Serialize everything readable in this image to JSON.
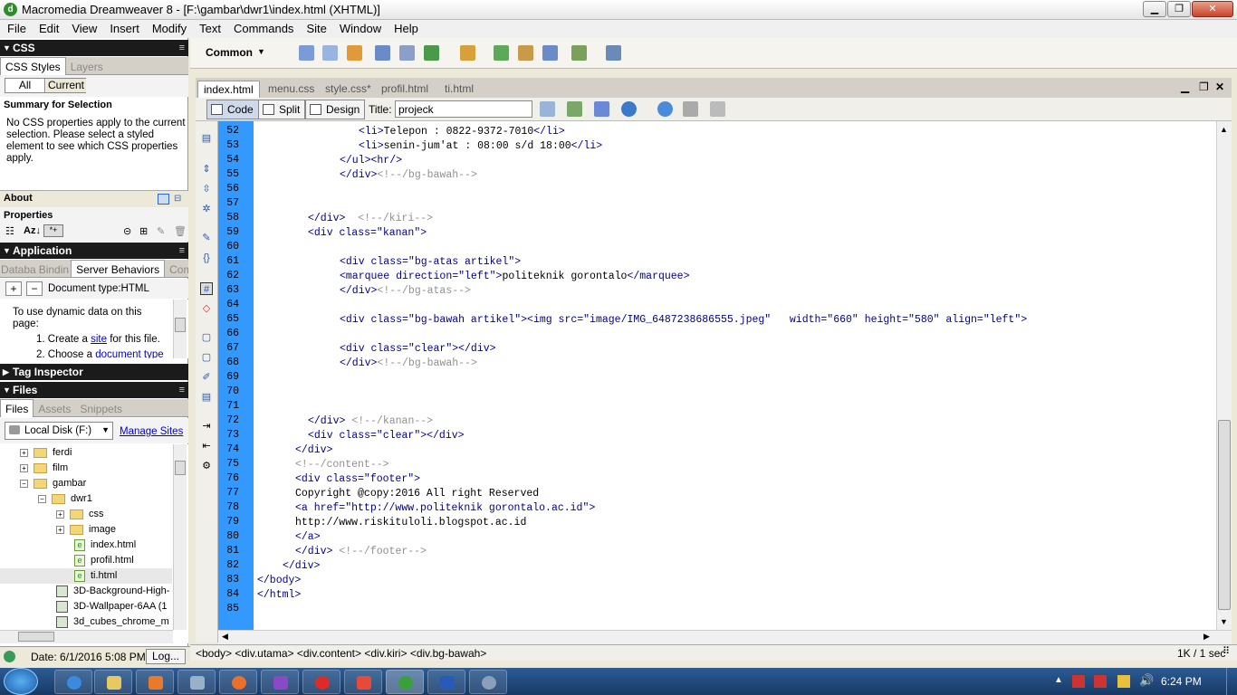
{
  "window": {
    "title": "Macromedia Dreamweaver 8 - [F:\\gambar\\dwr1\\index.html (XHTML)]"
  },
  "menu": [
    "File",
    "Edit",
    "View",
    "Insert",
    "Modify",
    "Text",
    "Commands",
    "Site",
    "Window",
    "Help"
  ],
  "css_panel": {
    "header": "CSS",
    "tabs": [
      "CSS Styles",
      "Layers"
    ],
    "buttons": [
      "All",
      "Current"
    ],
    "summary_title": "Summary for Selection",
    "summary_text": [
      "No CSS properties apply to the current",
      "selection.  Please select a styled",
      "element to see which CSS properties",
      "apply."
    ],
    "about": "About",
    "properties": "Properties"
  },
  "application_panel": {
    "header": "Application",
    "tabs": [
      "Databa",
      "Bindin",
      "Server Behaviors",
      "Compo"
    ],
    "doctype": "Document type:HTML",
    "info_line1": "To use dynamic data on this",
    "info_line2": "page:",
    "step1_num": "1.",
    "step1_pre": "Create a ",
    "step1_link": "site",
    "step1_post": " for this file.",
    "step2_num": "2.",
    "step2_pre": "Choose a ",
    "step2_link": "document type"
  },
  "tag_inspector": {
    "header": "Tag Inspector"
  },
  "files_panel": {
    "header": "Files",
    "tabs": [
      "Files",
      "Assets",
      "Snippets"
    ],
    "disk": "Local Disk (F:)",
    "manage": "Manage Sites",
    "tree": [
      "ferdi",
      "film",
      "gambar",
      "dwr1",
      "css",
      "image",
      "index.html",
      "profil.html",
      "ti.html",
      "3D-Background-High-",
      "3D-Wallpaper-6AA (1",
      "3d_cubes_chrome_m"
    ],
    "status_date": "Date: 6/1/2016 5:08 PM",
    "log_button": "Log..."
  },
  "insert_bar": {
    "category": "Common"
  },
  "doc_tabs": [
    "index.html",
    "menu.css",
    "style.css*",
    "profil.html",
    "ti.html"
  ],
  "doc_toolbar": {
    "code": "Code",
    "split": "Split",
    "design": "Design",
    "title_label": "Title:",
    "title_value": "projeck"
  },
  "code": {
    "line_numbers": [
      "52",
      "53",
      "54",
      "55",
      "56",
      "57",
      "58",
      "59",
      "60",
      "61",
      "62",
      "63",
      "64",
      "65",
      "66",
      "67",
      "68",
      "69",
      "70",
      "71",
      "72",
      "73",
      "74",
      "75",
      "76",
      "77",
      "78",
      "79",
      "80",
      "81",
      "82",
      "83",
      "84",
      "85"
    ]
  },
  "status": {
    "tags": "<body> <div.utama> <div.content> <div.kiri> <div.bg-bawah>",
    "size": "1K / 1 sec"
  },
  "taskbar": {
    "time": "6:24 PM"
  }
}
